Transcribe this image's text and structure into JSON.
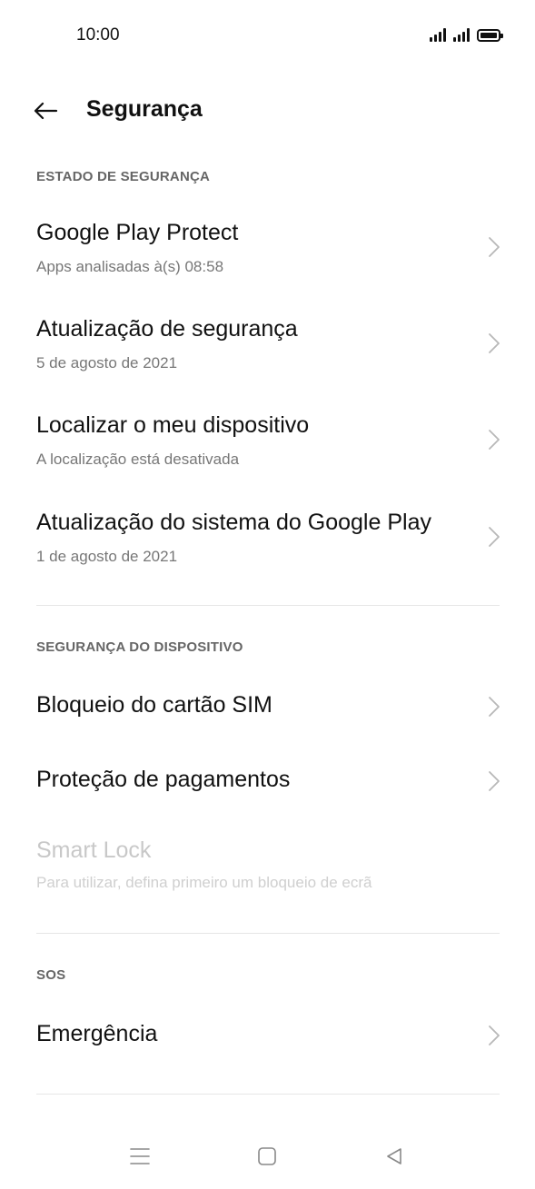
{
  "status_bar": {
    "time": "10:00"
  },
  "header": {
    "title": "Segurança"
  },
  "sections": {
    "security_status": {
      "title": "ESTADO DE SEGURANÇA",
      "items": [
        {
          "title": "Google Play Protect",
          "subtitle": "Apps analisadas à(s) 08:58"
        },
        {
          "title": "Atualização de segurança",
          "subtitle": "5 de agosto de 2021"
        },
        {
          "title": "Localizar o meu dispositivo",
          "subtitle": "A localização está desativada"
        },
        {
          "title": "Atualização do sistema do Google Play",
          "subtitle": "1 de agosto de 2021"
        }
      ]
    },
    "device_security": {
      "title": "SEGURANÇA DO DISPOSITIVO",
      "items": [
        {
          "title": "Bloqueio do cartão SIM"
        },
        {
          "title": "Proteção de pagamentos"
        },
        {
          "title": "Smart Lock",
          "subtitle": "Para utilizar, defina primeiro um bloqueio de ecrã"
        }
      ]
    },
    "sos": {
      "title": "SOS",
      "items": [
        {
          "title": "Emergência"
        }
      ]
    }
  },
  "icons": {
    "back": "arrow-left-icon",
    "chevron": "chevron-right-icon",
    "menu": "menu-icon",
    "home": "home-icon",
    "back_nav": "back-triangle-icon"
  },
  "colors": {
    "background": "#ffffff",
    "title_text": "#111111",
    "subtitle_text": "#777777",
    "section_header": "#666666",
    "disabled_text": "#c8c8c8",
    "divider": "#e6e6e6"
  }
}
